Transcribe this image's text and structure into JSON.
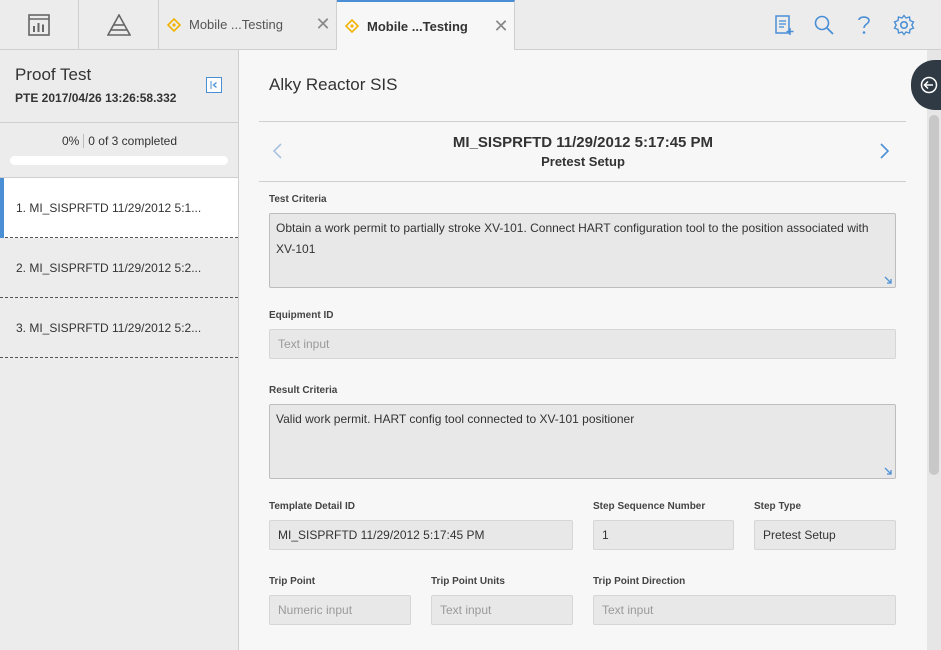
{
  "topbar": {
    "tabs": [
      {
        "label": "Mobile ...Testing",
        "close": "✕"
      },
      {
        "label": "Mobile ...Testing",
        "close": "✕"
      }
    ]
  },
  "left_panel": {
    "title": "Proof Test",
    "subtitle": "PTE 2017/04/26 13:26:58.332",
    "progress": {
      "percent_label": "0%",
      "completed_label": "0 of 3 completed",
      "fraction": 0
    },
    "steps": [
      {
        "label": "1. MI_SISPRFTD 11/29/2012 5:1..."
      },
      {
        "label": "2. MI_SISPRFTD 11/29/2012 5:2..."
      },
      {
        "label": "3. MI_SISPRFTD 11/29/2012 5:2..."
      }
    ]
  },
  "main": {
    "title": "Alky Reactor SIS",
    "step_title": "MI_SISPRFTD 11/29/2012 5:17:45 PM",
    "step_subtitle": "Pretest Setup",
    "fields": {
      "test_criteria": {
        "label": "Test Criteria",
        "value": "Obtain a work permit to partially stroke XV-101.  Connect HART configuration tool to the position associated with XV-101"
      },
      "equipment_id": {
        "label": "Equipment ID",
        "placeholder": "Text input"
      },
      "result_criteria": {
        "label": "Result Criteria",
        "value": "Valid work permit.  HART config tool connected to XV-101 positioner"
      },
      "template_detail_id": {
        "label": "Template Detail ID",
        "value": "MI_SISPRFTD 11/29/2012 5:17:45 PM"
      },
      "step_sequence_number": {
        "label": "Step Sequence Number",
        "value": "1"
      },
      "step_type": {
        "label": "Step Type",
        "value": "Pretest Setup"
      },
      "trip_point": {
        "label": "Trip Point",
        "placeholder": "Numeric input"
      },
      "trip_point_units": {
        "label": "Trip Point Units",
        "placeholder": "Text input"
      },
      "trip_point_direction": {
        "label": "Trip Point Direction",
        "placeholder": "Text input"
      }
    }
  },
  "colors": {
    "accent": "#4a8fd6",
    "tab_icon": "#f0b400",
    "fab": "#2f3a44"
  }
}
